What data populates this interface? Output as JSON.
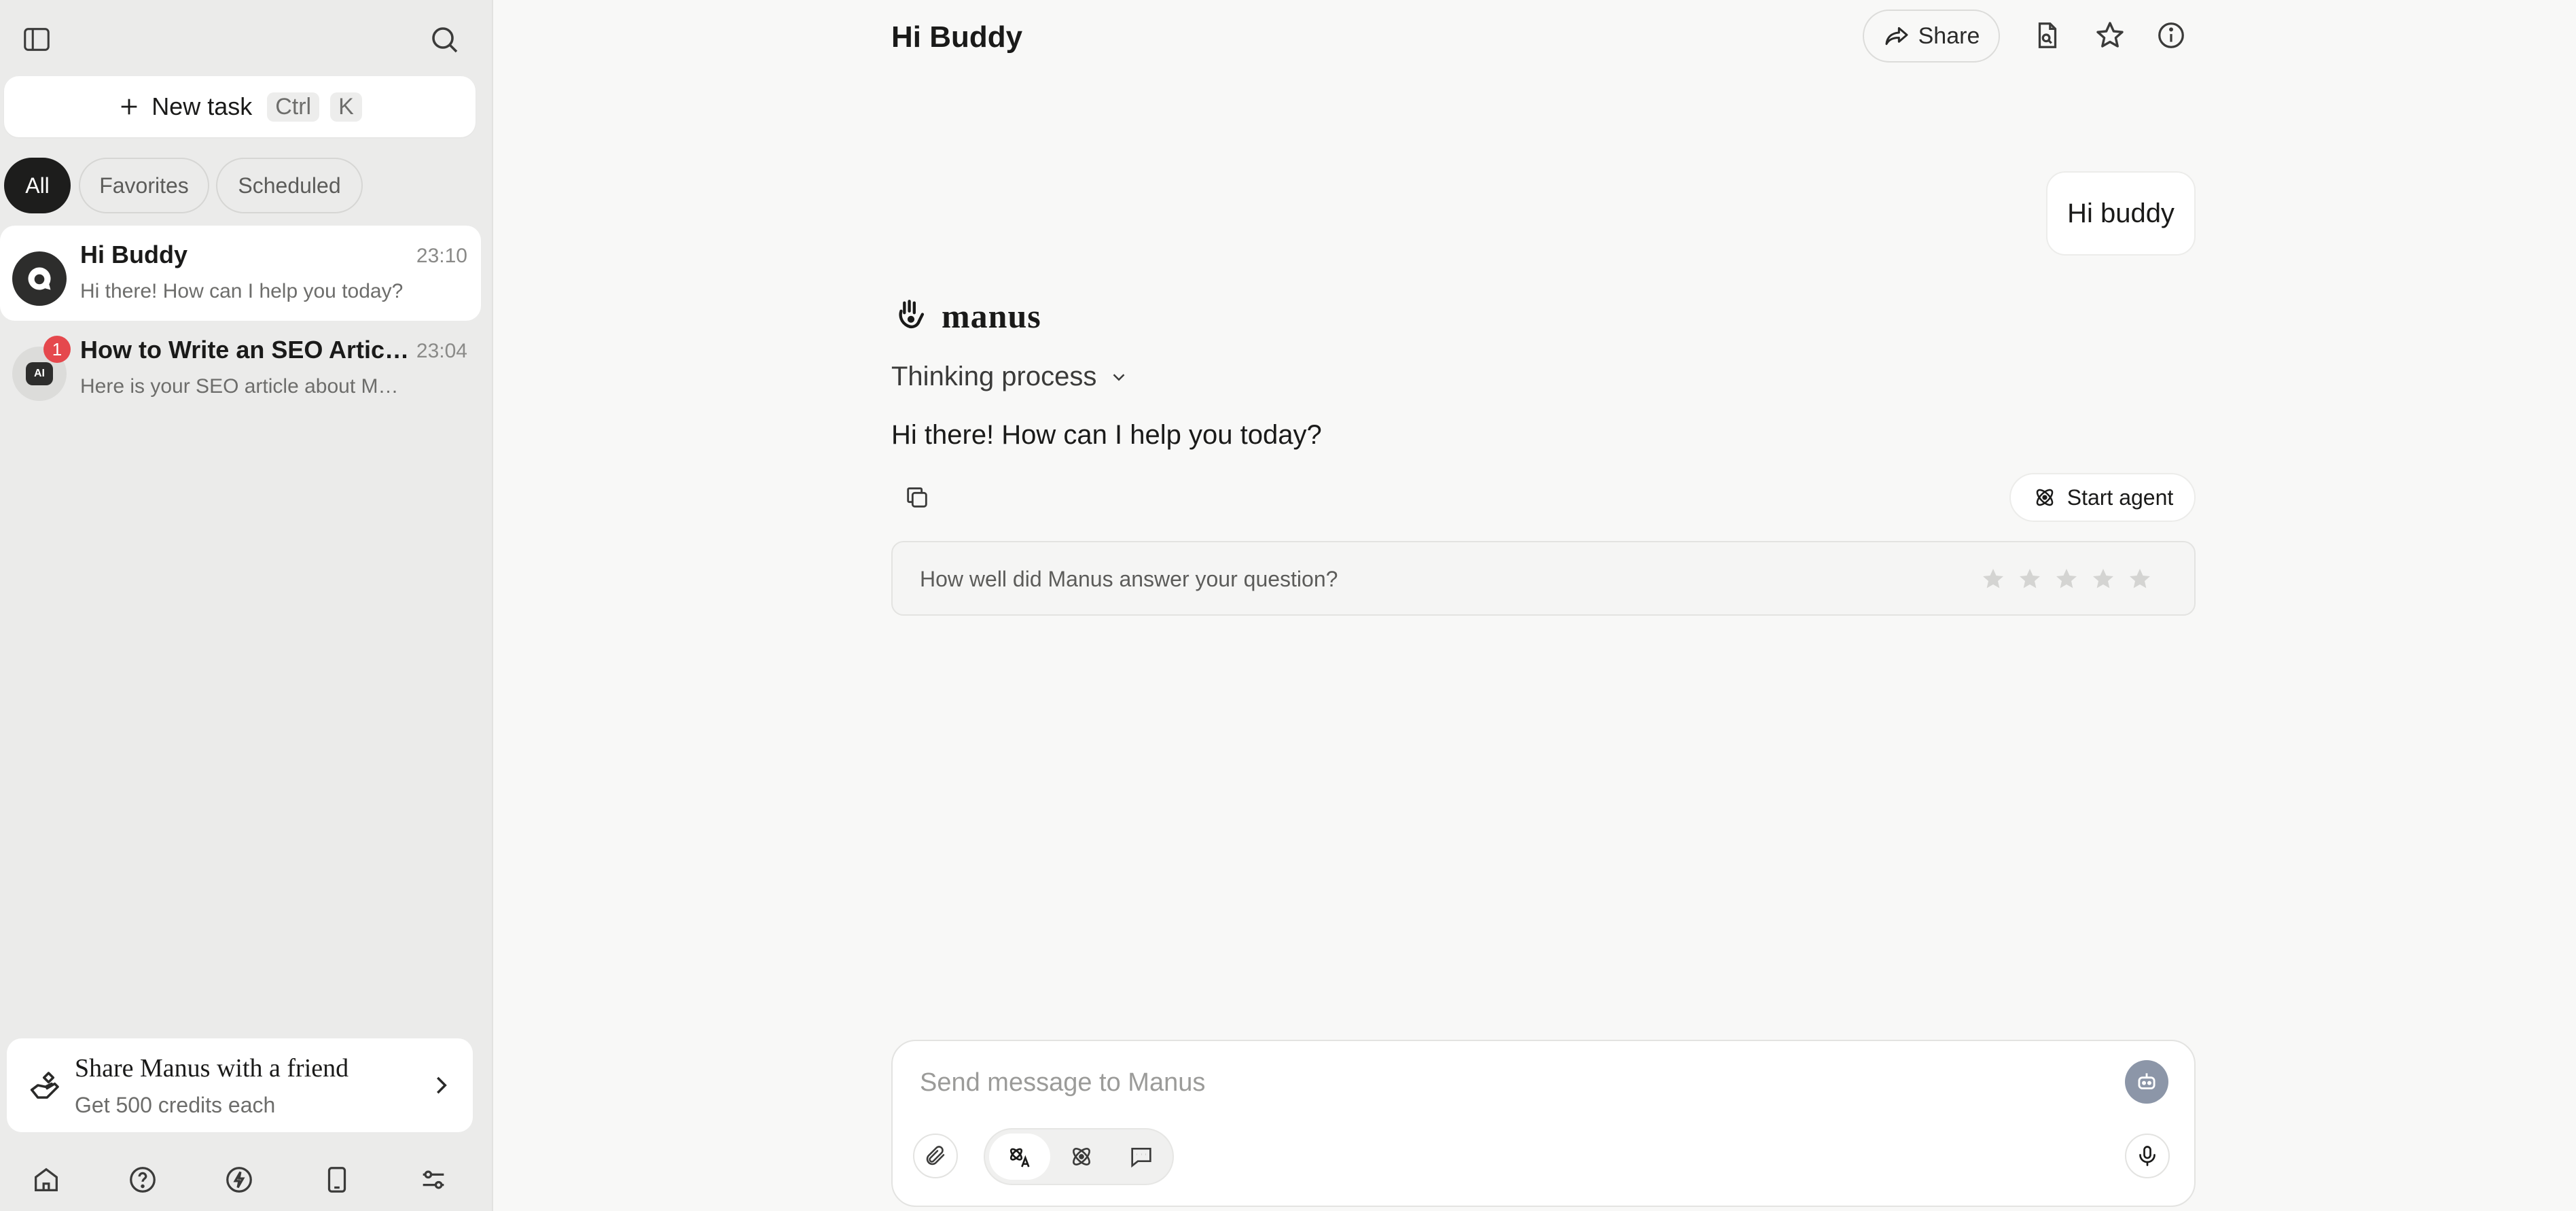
{
  "sidebar": {
    "new_task": {
      "label": "New task",
      "shortcut_ctrl": "Ctrl",
      "shortcut_key": "K"
    },
    "filters": [
      {
        "label": "All",
        "active": true
      },
      {
        "label": "Favorites",
        "active": false
      },
      {
        "label": "Scheduled",
        "active": false
      }
    ],
    "tasks": [
      {
        "title": "Hi Buddy",
        "time": "23:10",
        "preview": "Hi there! How can I help you today?",
        "active": true
      },
      {
        "title": "How to Write an SEO Article ...",
        "time": "23:04",
        "preview": "Here is your SEO article about Man...",
        "badge": "1",
        "avatar_text": "AI"
      }
    ],
    "share_card": {
      "title": "Share Manus with a friend",
      "subtitle": "Get 500 credits each"
    },
    "bottom_icons": [
      "home-icon",
      "help-icon",
      "lightning-icon",
      "tablet-icon",
      "sliders-icon"
    ]
  },
  "header": {
    "title": "Hi Buddy",
    "share_label": "Share"
  },
  "chat": {
    "user_message": "Hi buddy",
    "brand_name": "manus",
    "thinking_label": "Thinking process",
    "assistant_reply": "Hi there! How can I help you today?",
    "start_agent_label": "Start agent",
    "rating_question": "How well did Manus answer your question?",
    "rating_stars": 5,
    "rating_value": 0
  },
  "composer": {
    "placeholder": "Send message to Manus"
  },
  "colors": {
    "accent_dark": "#1d1d1c",
    "badge_red": "#e5484d",
    "background": "#f8f8f7",
    "sidebar_bg": "#ebebea"
  }
}
